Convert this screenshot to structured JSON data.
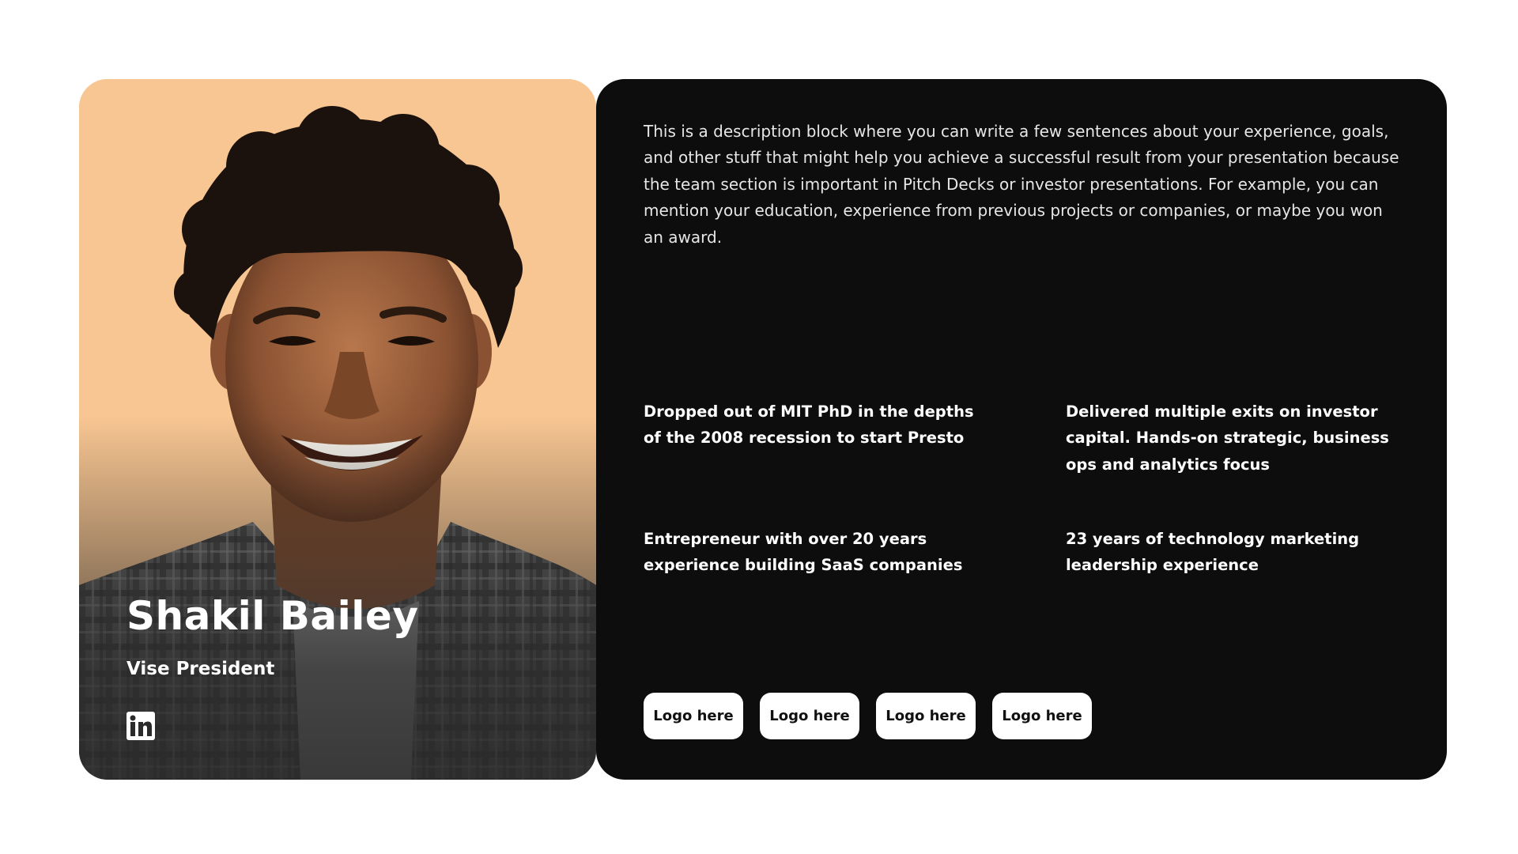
{
  "profile": {
    "name": "Shakil Bailey",
    "role": "Vise President",
    "social_icon": "linkedin-icon",
    "background_color": "#f8c692"
  },
  "info": {
    "description": "This is a description block where you can write a few sentences about your experience, goals, and other stuff that might help you achieve a successful result from your presentation because the team section is important in Pitch Decks or investor presentations. For example, you can mention your education, experience from previous projects or companies, or maybe you won an award.",
    "facts": [
      "Dropped out of MIT PhD in the depths of the 2008 recession to start Presto",
      "Delivered multiple exits on investor capital. Hands-on strategic, business ops and analytics focus",
      "Entrepreneur with over 20 years experience building SaaS companies",
      "23 years of technology marketing leadership experience"
    ],
    "logos": [
      "Logo here",
      "Logo here",
      "Logo here",
      "Logo here"
    ],
    "card_color": "#0d0d0d"
  }
}
